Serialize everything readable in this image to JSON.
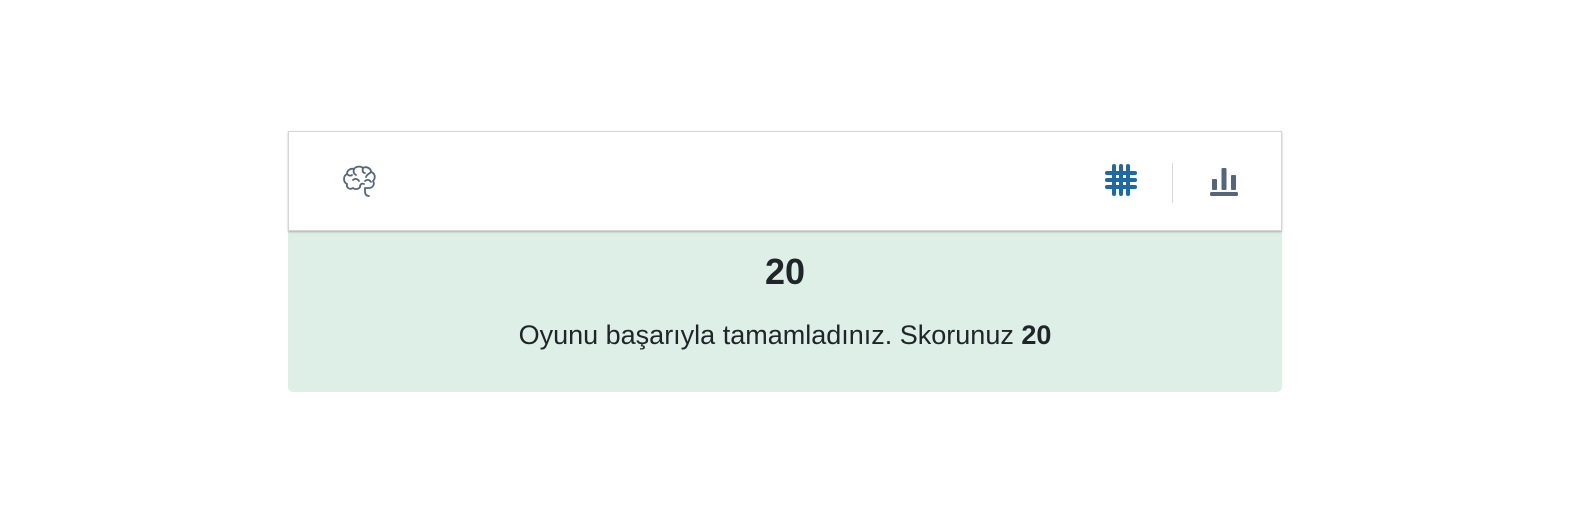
{
  "toolbar": {
    "logo_icon": "brain-icon",
    "grid_icon": "grid-icon",
    "stats_icon": "bar-chart-icon",
    "colors": {
      "icon_muted": "#56667a",
      "icon_active": "#1f6aa5"
    }
  },
  "result": {
    "score": "20",
    "message_prefix": "Oyunu başarıyla tamamladınız. Skorunuz",
    "message_score": "20",
    "background": "#ddefe7"
  }
}
